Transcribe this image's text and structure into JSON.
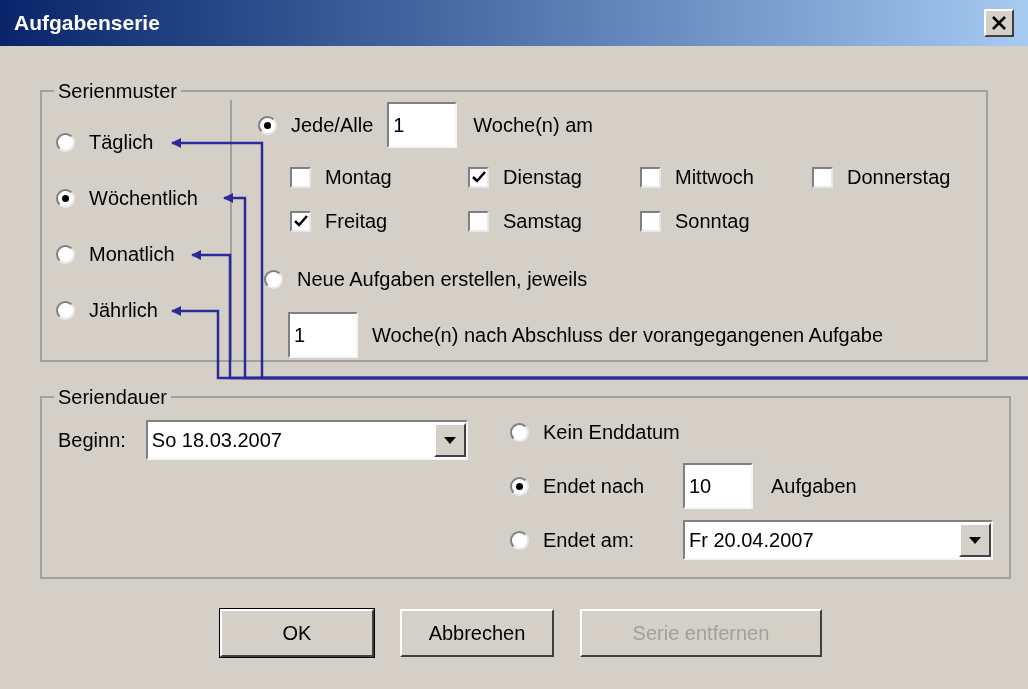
{
  "window": {
    "title": "Aufgabenserie"
  },
  "pattern": {
    "legend": "Serienmuster",
    "frequencies": [
      {
        "label": "Täglich",
        "selected": false
      },
      {
        "label": "Wöchentlich",
        "selected": true
      },
      {
        "label": "Monatlich",
        "selected": false
      },
      {
        "label": "Jährlich",
        "selected": false
      }
    ],
    "every": {
      "label": "Jede/Alle",
      "selected": true,
      "value": "1",
      "unit": "Woche(n) am"
    },
    "days": [
      {
        "label": "Montag",
        "checked": false
      },
      {
        "label": "Dienstag",
        "checked": true
      },
      {
        "label": "Mittwoch",
        "checked": false
      },
      {
        "label": "Donnerstag",
        "checked": false
      },
      {
        "label": "Freitag",
        "checked": true
      },
      {
        "label": "Samstag",
        "checked": false
      },
      {
        "label": "Sonntag",
        "checked": false
      }
    ],
    "regenerate": {
      "label": "Neue Aufgaben erstellen, jeweils",
      "selected": false,
      "value": "1",
      "unit": "Woche(n) nach Abschluss der vorangegangenen Aufgabe"
    }
  },
  "duration": {
    "legend": "Seriendauer",
    "start_label": "Beginn:",
    "start_value": "So 18.03.2007",
    "end_options": [
      {
        "kind": "none",
        "label": "Kein Enddatum",
        "selected": false
      },
      {
        "kind": "count",
        "label": "Endet nach",
        "selected": true,
        "value": "10",
        "unit": "Aufgaben"
      },
      {
        "kind": "date",
        "label": "Endet am:",
        "selected": false,
        "value": "Fr 20.04.2007"
      }
    ]
  },
  "buttons": [
    {
      "label": "OK",
      "disabled": false,
      "default": true
    },
    {
      "label": "Abbrechen",
      "disabled": false,
      "default": false
    },
    {
      "label": "Serie entfernen",
      "disabled": true,
      "default": false
    }
  ]
}
